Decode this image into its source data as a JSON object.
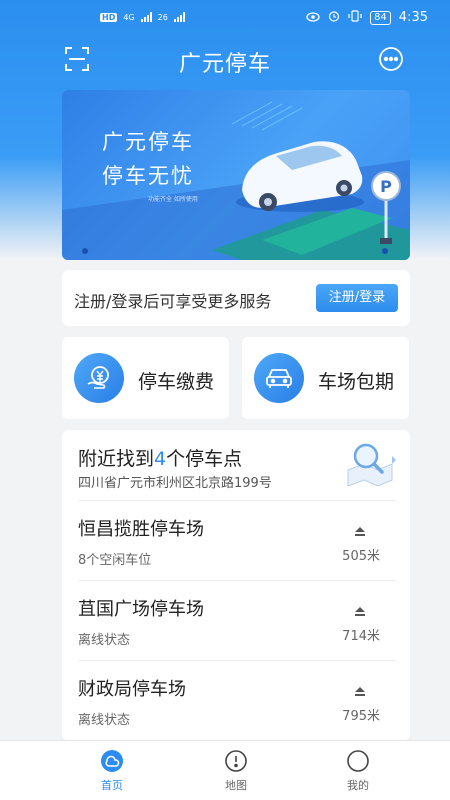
{
  "status_bar": {
    "hd": "HD",
    "net1": "4G",
    "net2": "26",
    "battery": "84",
    "time": "4:35"
  },
  "header": {
    "title": "广元停车"
  },
  "banner": {
    "line1": "广元停车",
    "line2": "停车无忧",
    "small": "功能齐全 如所使用",
    "sign": "P"
  },
  "login": {
    "prompt": "注册/登录后可享受更多服务",
    "button": "注册/登录"
  },
  "quick": [
    {
      "label": "停车缴费",
      "icon": "yen-hand-icon"
    },
    {
      "label": "车场包期",
      "icon": "car-icon"
    }
  ],
  "nearby": {
    "title_prefix": "附近找到",
    "count": "4",
    "title_suffix": "个停车点",
    "address": "四川省广元市利州区北京路199号",
    "lots": [
      {
        "name": "恒昌揽胜停车场",
        "status": "8个空闲车位",
        "distance": "505米"
      },
      {
        "name": "苴国广场停车场",
        "status": "离线状态",
        "distance": "714米"
      },
      {
        "name": "财政局停车场",
        "status": "离线状态",
        "distance": "795米"
      }
    ]
  },
  "tabs": [
    {
      "label": "首页",
      "icon": "home-icon",
      "active": true
    },
    {
      "label": "地图",
      "icon": "map-pin-icon",
      "active": false
    },
    {
      "label": "我的",
      "icon": "user-icon",
      "active": false
    }
  ],
  "colors": {
    "primary": "#2d8cef",
    "background": "#f2f3f5"
  }
}
